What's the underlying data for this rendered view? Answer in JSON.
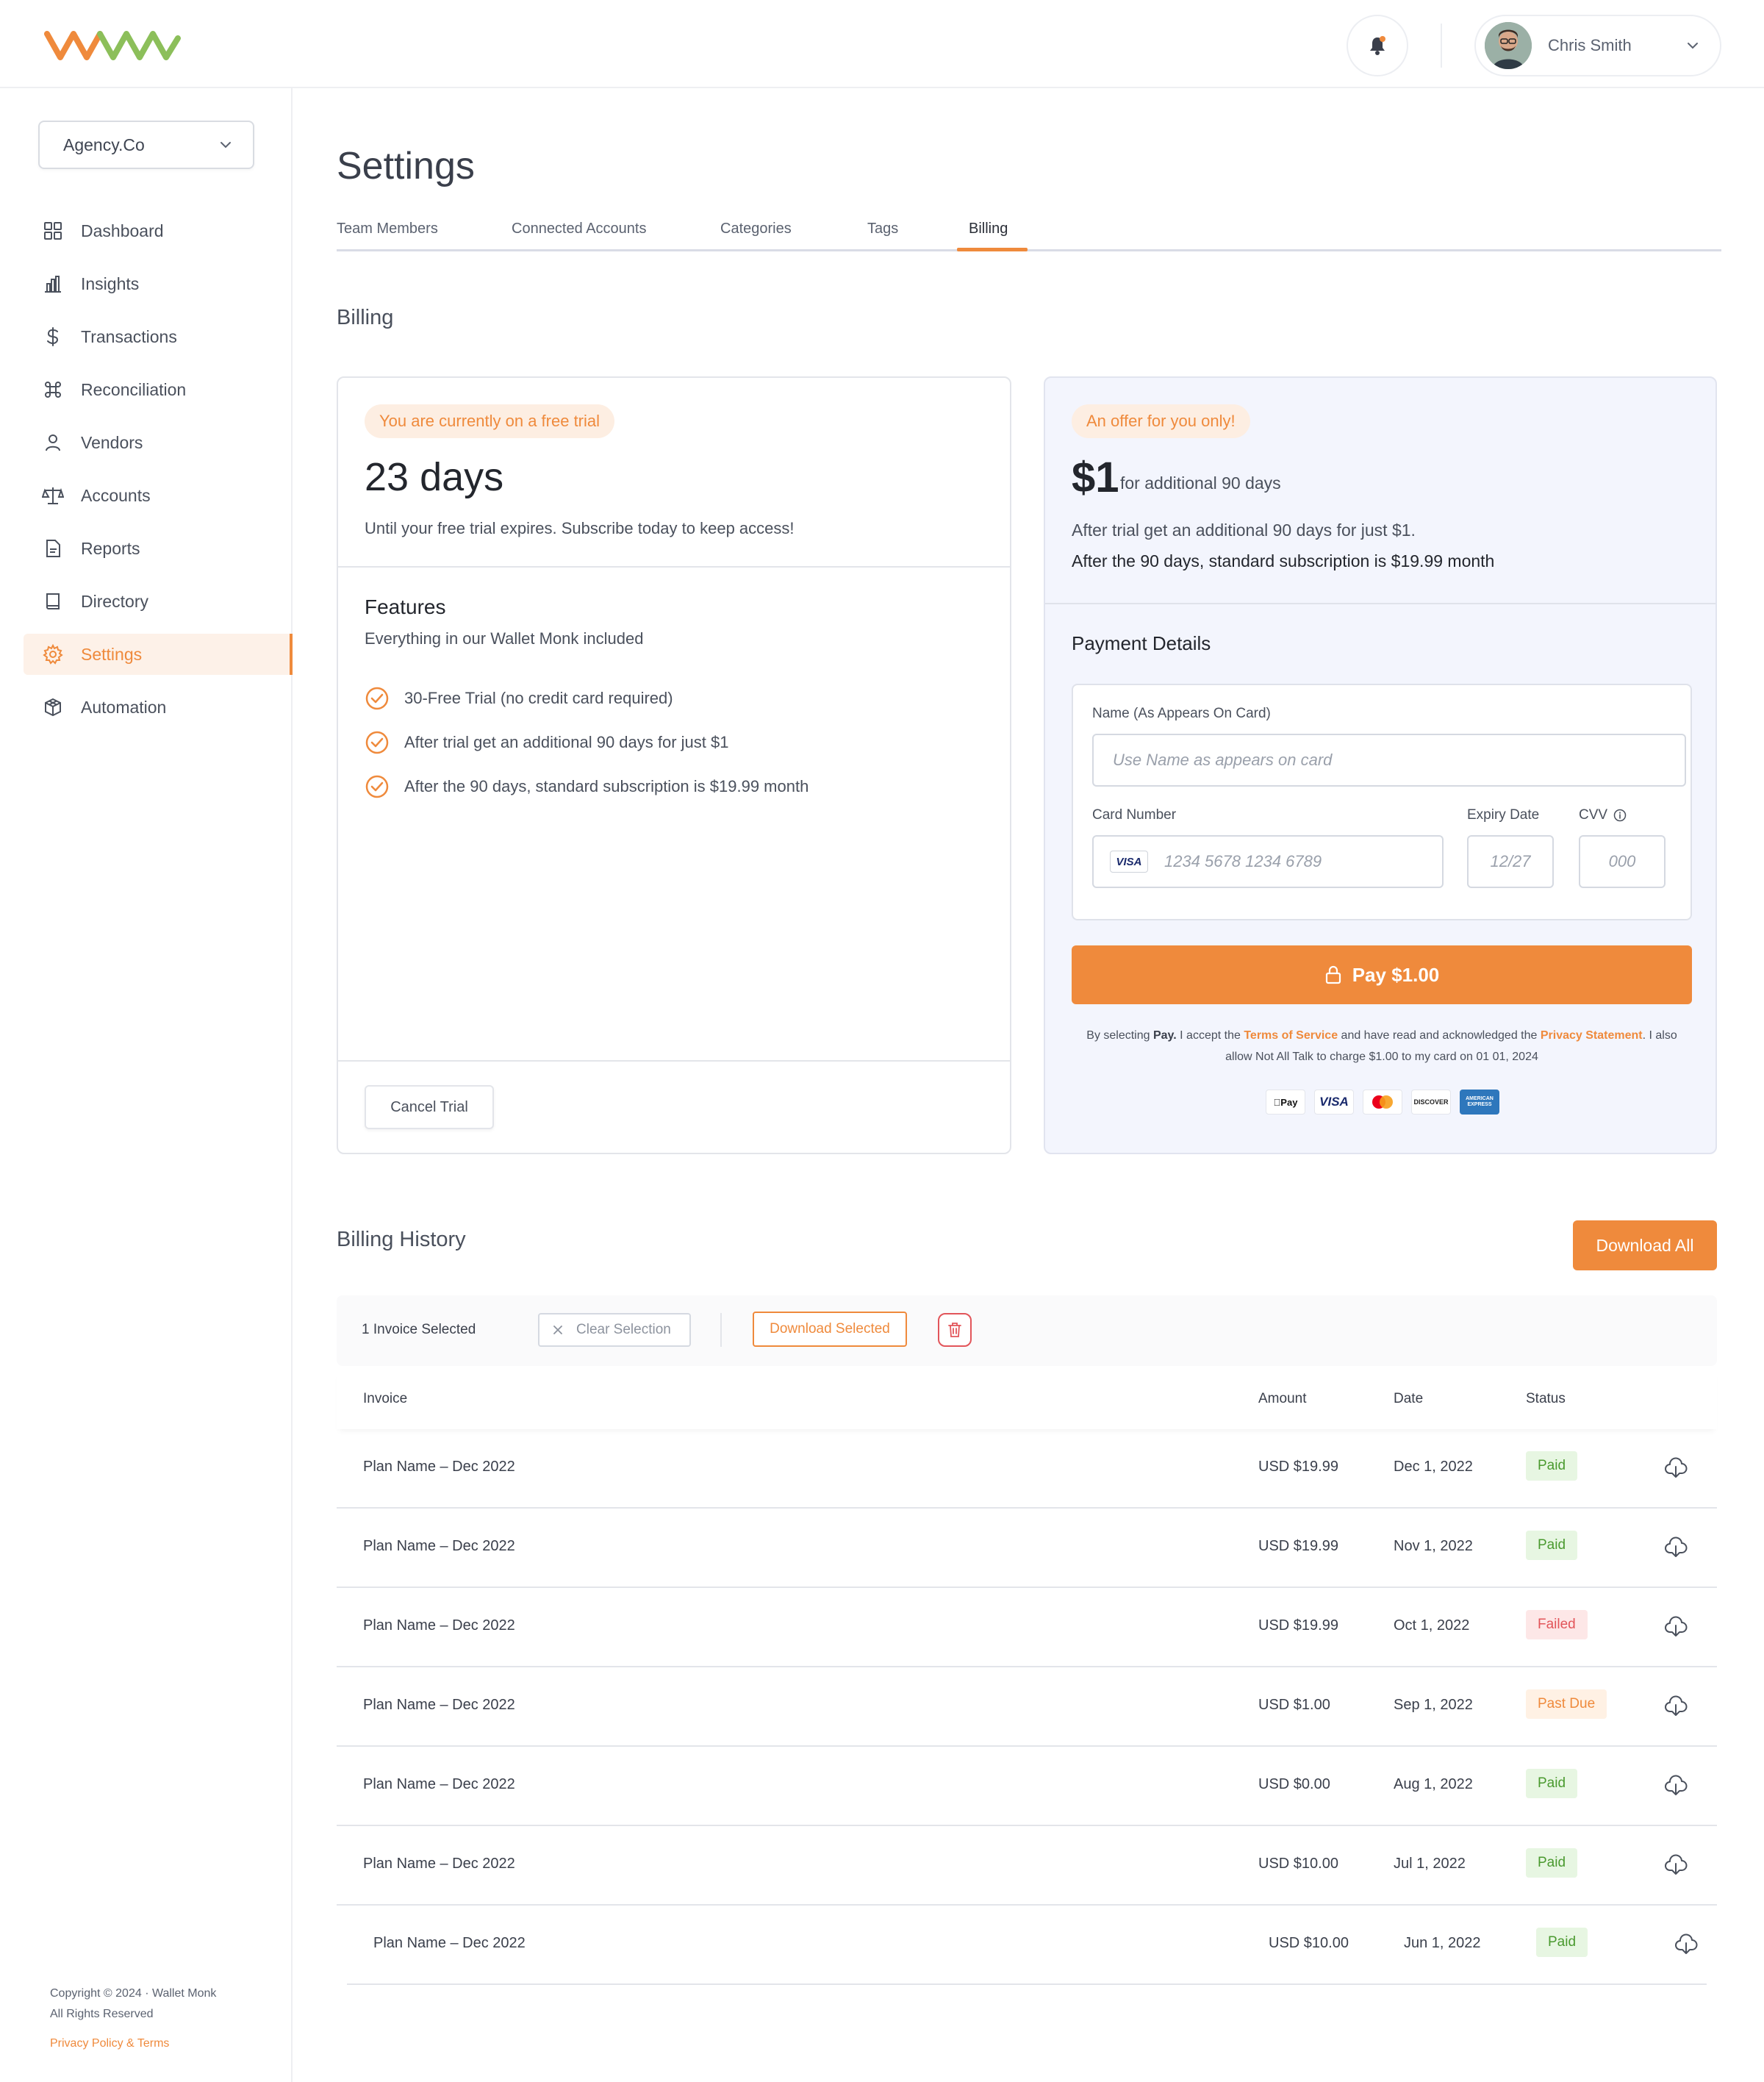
{
  "header": {
    "user_name": "Chris Smith"
  },
  "sidebar": {
    "org": "Agency.Co",
    "items": [
      {
        "label": "Dashboard",
        "icon": "grid-icon"
      },
      {
        "label": "Insights",
        "icon": "bar-chart-icon"
      },
      {
        "label": "Transactions",
        "icon": "dollar-icon"
      },
      {
        "label": "Reconciliation",
        "icon": "command-icon"
      },
      {
        "label": "Vendors",
        "icon": "user-icon"
      },
      {
        "label": "Accounts",
        "icon": "scale-icon"
      },
      {
        "label": "Reports",
        "icon": "file-icon"
      },
      {
        "label": "Directory",
        "icon": "book-icon"
      },
      {
        "label": "Settings",
        "icon": "gear-icon",
        "active": true
      },
      {
        "label": "Automation",
        "icon": "cube-icon"
      }
    ],
    "footer": {
      "copyright": "Copyright © 2024 · Wallet Monk",
      "rights": "All Rights Reserved",
      "links": "Privacy Policy & Terms"
    }
  },
  "page": {
    "title": "Settings",
    "tabs": [
      "Team Members",
      "Connected Accounts",
      "Categories",
      "Tags",
      "Billing"
    ],
    "active_tab": "Billing",
    "section_title": "Billing"
  },
  "trial": {
    "badge": "You are currently on a free trial",
    "days": "23 days",
    "subtitle": "Until your free trial expires. Subscribe today to keep access!",
    "features_title": "Features",
    "features_subtitle": "Everything in our Wallet Monk included",
    "features": [
      "30-Free Trial (no credit card required)",
      "After trial get an additional 90 days for just $1",
      "After the 90 days, standard subscription is $19.99 month"
    ],
    "cancel_label": "Cancel Trial"
  },
  "offer": {
    "badge": "An offer for you only!",
    "price": "$1",
    "price_note": "for additional 90 days",
    "line1": "After trial get an additional 90 days for just $1.",
    "line2": "After the 90 days, standard subscription is $19.99 month",
    "payment_title": "Payment Details",
    "name_label": "Name (As Appears On Card)",
    "name_placeholder": "Use Name as appears on card",
    "card_label": "Card Number",
    "card_brand": "VISA",
    "card_placeholder": "1234 5678 1234 6789",
    "expiry_label": "Expiry Date",
    "expiry_placeholder": "12/27",
    "cvv_label": "CVV",
    "cvv_placeholder": "000",
    "pay_label": "Pay $1.00",
    "legal_1": "By selecting ",
    "legal_pay": "Pay.",
    "legal_2": " I accept the ",
    "legal_tos": "Terms of Service",
    "legal_3": " and have read and  acknowledged the ",
    "legal_privacy": "Privacy Statement",
    "legal_4": ". I also allow Not All Talk to charge $1.00 to my card on 01 01, 2024",
    "brands": [
      "Apple Pay",
      "VISA",
      "Mastercard",
      "DISCOVER",
      "AMERICAN EXPRESS"
    ]
  },
  "history": {
    "title": "Billing History",
    "download_all": "Download All",
    "selected_text": "1 Invoice Selected",
    "clear_label": "Clear Selection",
    "download_selected": "Download Selected",
    "columns": [
      "Invoice",
      "Amount",
      "Date",
      "Status"
    ],
    "rows": [
      {
        "invoice": "Plan Name – Dec 2022",
        "amount": "USD $19.99",
        "date": "Dec 1, 2022",
        "status": "Paid",
        "kind": "paid"
      },
      {
        "invoice": "Plan Name – Dec 2022",
        "amount": "USD $19.99",
        "date": "Nov 1, 2022",
        "status": "Paid",
        "kind": "paid"
      },
      {
        "invoice": "Plan Name – Dec 2022",
        "amount": "USD $19.99",
        "date": "Oct 1, 2022",
        "status": "Failed",
        "kind": "failed"
      },
      {
        "invoice": "Plan Name – Dec 2022",
        "amount": "USD $1.00",
        "date": "Sep 1, 2022",
        "status": "Past Due",
        "kind": "pastdue"
      },
      {
        "invoice": "Plan Name – Dec 2022",
        "amount": "USD $0.00",
        "date": "Aug 1, 2022",
        "status": "Paid",
        "kind": "paid"
      },
      {
        "invoice": "Plan Name – Dec 2022",
        "amount": "USD $10.00",
        "date": "Jul 1, 2022",
        "status": "Paid",
        "kind": "paid"
      },
      {
        "invoice": "Plan Name – Dec 2022",
        "amount": "USD $10.00",
        "date": "Jun 1, 2022",
        "status": "Paid",
        "kind": "paid"
      }
    ]
  },
  "colors": {
    "accent": "#ef8a3c",
    "offer_bg": "#f3f5fd",
    "paid": "#4a9a2f",
    "failed": "#e2555a"
  }
}
